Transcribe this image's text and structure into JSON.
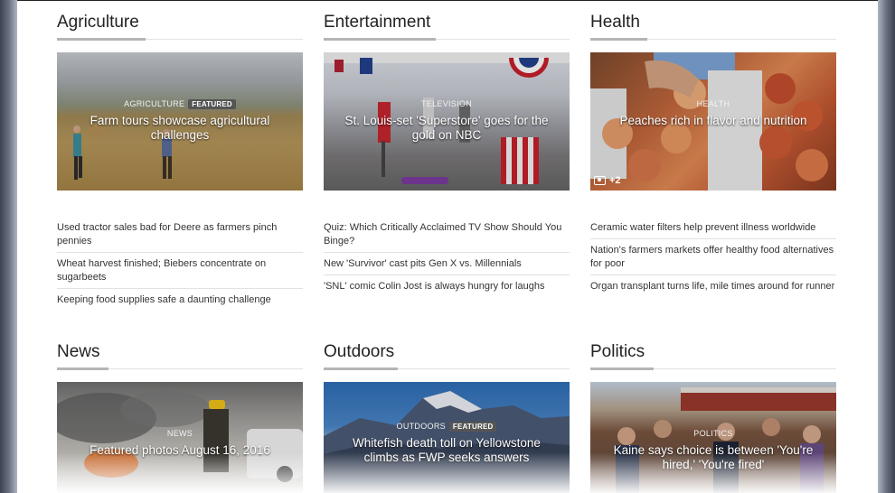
{
  "sections": [
    {
      "title": "Agriculture",
      "card": {
        "category": "Agriculture",
        "badge": "Featured",
        "title": "Farm tours showcase agricultural challenges"
      },
      "stories": [
        "Used tractor sales bad for Deere as farmers pinch pennies",
        "Wheat harvest finished; Biebers concentrate on sugarbeets",
        "Keeping food supplies safe a daunting challenge"
      ]
    },
    {
      "title": "Entertainment",
      "card": {
        "category": "Television",
        "title": "St. Louis-set 'Superstore' goes for the gold on NBC"
      },
      "stories": [
        "Quiz: Which Critically Acclaimed TV Show Should You Binge?",
        "New 'Survivor' cast pits Gen X vs. Millennials",
        "'SNL' comic Colin Jost is always hungry for laughs"
      ]
    },
    {
      "title": "Health",
      "card": {
        "category": "Health",
        "title": "Peaches rich in flavor and nutrition",
        "photo_count": "+2"
      },
      "stories": [
        "Ceramic water filters help prevent illness worldwide",
        "Nation's farmers markets offer healthy food alternatives for poor",
        "Organ transplant turns life, mile times around for runner"
      ]
    },
    {
      "title": "News",
      "card": {
        "category": "News",
        "title": "Featured photos August 16, 2016"
      }
    },
    {
      "title": "Outdoors",
      "card": {
        "category": "Outdoors",
        "badge": "Featured",
        "title": "Whitefish death toll on Yellowstone climbs as FWP seeks answers"
      }
    },
    {
      "title": "Politics",
      "card": {
        "category": "Politics",
        "title": "Kaine says choice is between 'You're hired,' 'You're fired'"
      }
    }
  ]
}
